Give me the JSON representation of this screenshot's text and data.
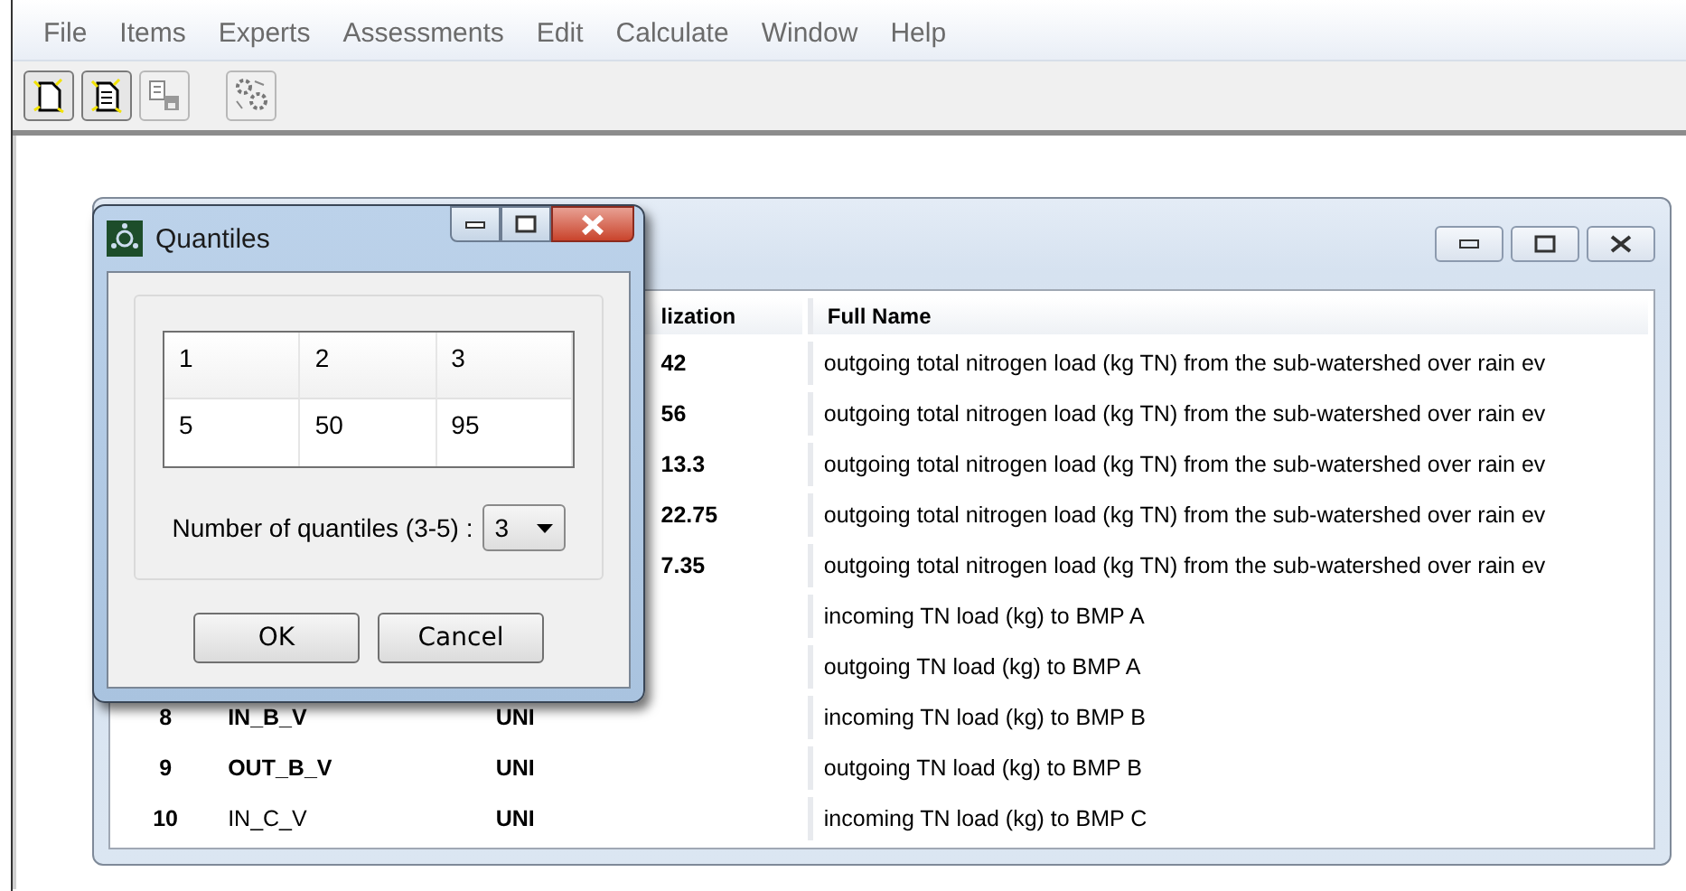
{
  "menu": [
    "File",
    "Items",
    "Experts",
    "Assessments",
    "Edit",
    "Calculate",
    "Window",
    "Help"
  ],
  "toolbar": [
    {
      "kind": "new",
      "disabled": false
    },
    {
      "kind": "open",
      "disabled": false
    },
    {
      "kind": "save",
      "disabled": true
    },
    {
      "kind": "gears",
      "disabled": true
    }
  ],
  "table": {
    "columns": [
      "lization",
      "Full Name"
    ],
    "rows": [
      {
        "realization": "42",
        "full_name": "outgoing total nitrogen load (kg TN) from the sub-watershed over rain ev"
      },
      {
        "realization": "56",
        "full_name": "outgoing total nitrogen load (kg TN) from the sub-watershed over rain ev"
      },
      {
        "realization": "13.3",
        "full_name": "outgoing total nitrogen load (kg TN) from the sub-watershed over rain ev"
      },
      {
        "realization": "22.75",
        "full_name": "outgoing total nitrogen load (kg TN) from the sub-watershed over rain ev"
      },
      {
        "realization": "7.35",
        "full_name": "outgoing total nitrogen load (kg TN) from the sub-watershed over rain ev"
      },
      {
        "full_name": "incoming TN load (kg) to BMP A"
      },
      {
        "full_name": "outgoing TN load (kg) to BMP A"
      },
      {
        "index": "8",
        "name": "IN_B_V",
        "bold": true,
        "type": "UNI",
        "full_name": "incoming TN load (kg) to BMP B"
      },
      {
        "index": "9",
        "name": "OUT_B_V",
        "bold": true,
        "type": "UNI",
        "full_name": "outgoing TN load (kg) to BMP B"
      },
      {
        "index": "10",
        "name": "IN_C_V",
        "bold": false,
        "type": "UNI",
        "full_name": "incoming TN load (kg) to BMP C"
      }
    ]
  },
  "dialog": {
    "title": "Quantiles",
    "grid": [
      [
        "1",
        "2",
        "3"
      ],
      [
        "5",
        "50",
        "95"
      ]
    ],
    "count_label": "Number of quantiles (3-5) :",
    "count_value": "3",
    "buttons": [
      "OK",
      "Cancel"
    ]
  }
}
